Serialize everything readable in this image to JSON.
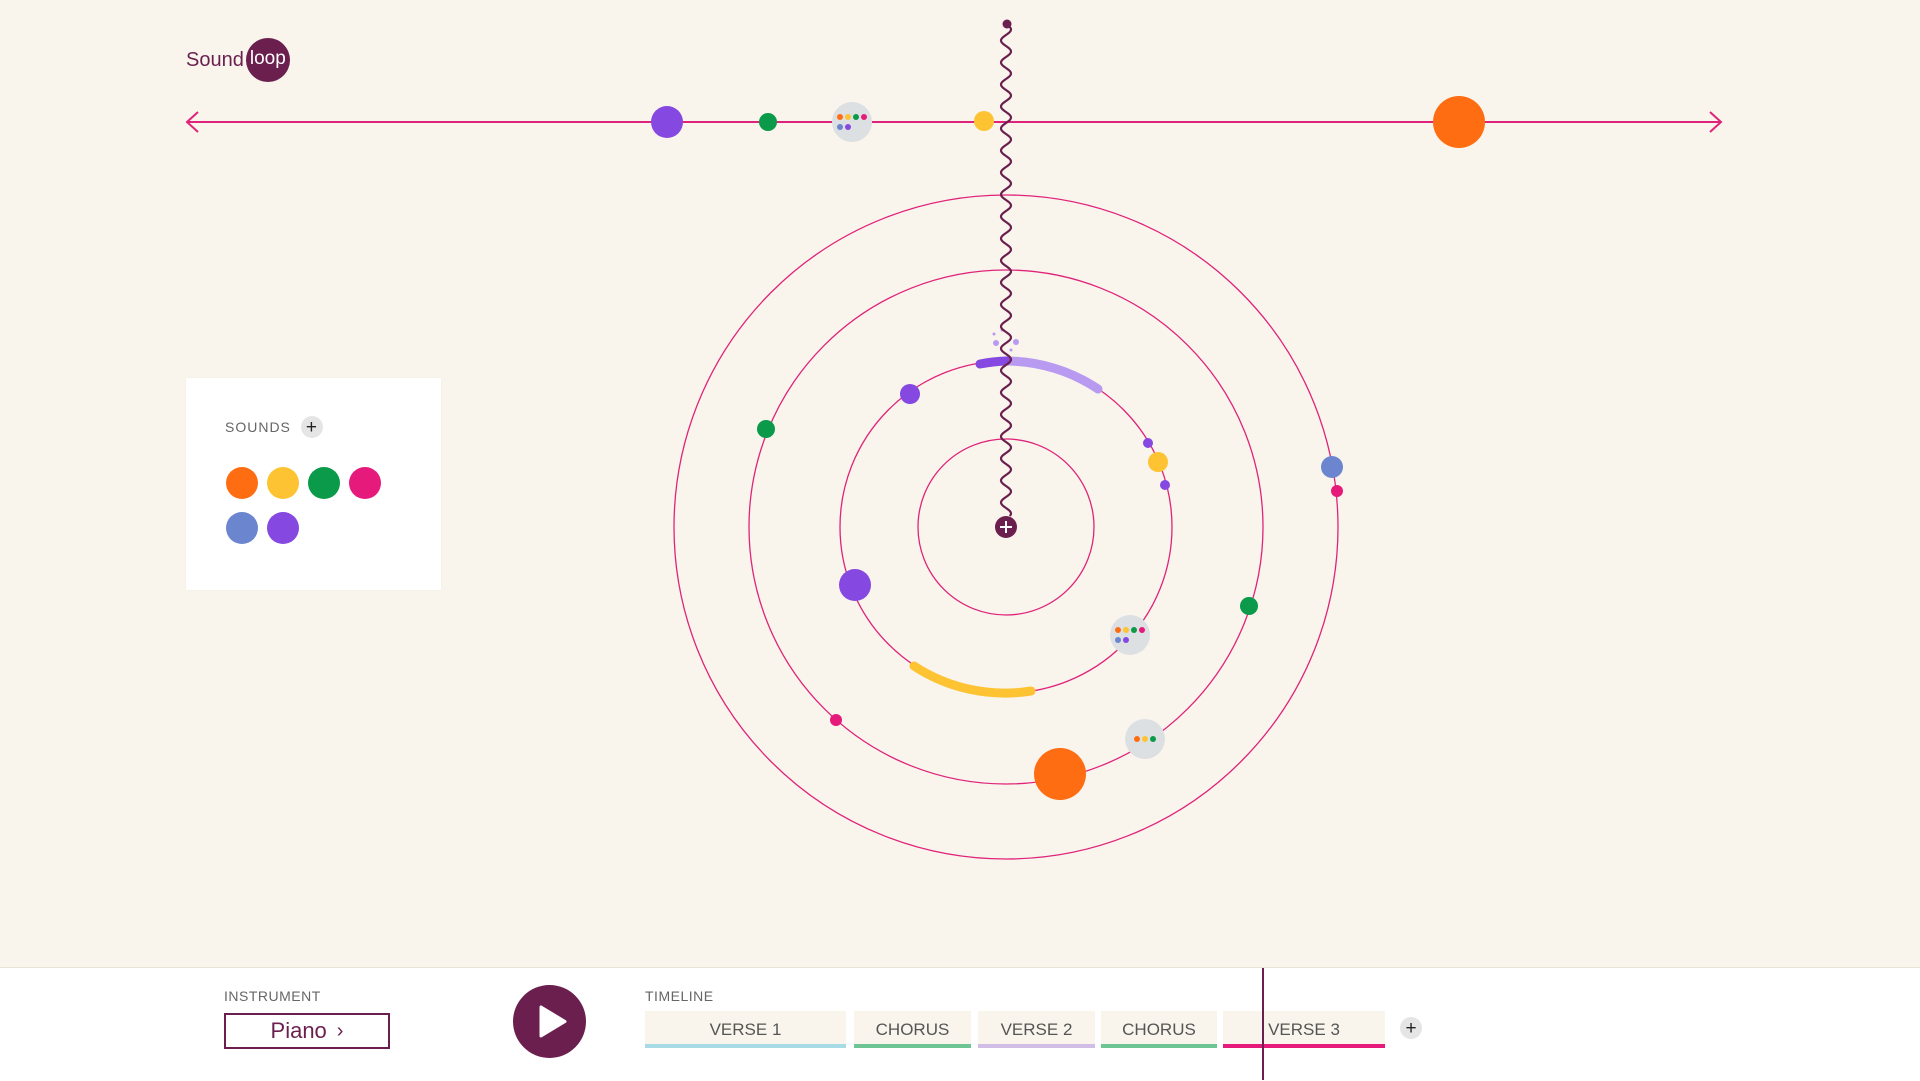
{
  "app": {
    "logo_word": "Sound",
    "logo_badge": "loop"
  },
  "colors": {
    "brand": "#6b1f4e",
    "accent_line": "#e0237a",
    "orange": "#ff6d12",
    "yellow": "#fdc333",
    "green": "#0a9a4a",
    "pink": "#e51a7b",
    "blue": "#6b85cf",
    "purple": "#8548e0",
    "group_bg": "#dde0e3"
  },
  "sounds_panel": {
    "title": "SOUNDS",
    "add_label": "+",
    "swatches": [
      {
        "name": "orange",
        "color": "#ff6d12"
      },
      {
        "name": "yellow",
        "color": "#fdc333"
      },
      {
        "name": "green",
        "color": "#0a9a4a"
      },
      {
        "name": "pink",
        "color": "#e51a7b"
      },
      {
        "name": "blue",
        "color": "#6b85cf"
      },
      {
        "name": "purple",
        "color": "#8548e0"
      }
    ]
  },
  "instrument": {
    "label": "INSTRUMENT",
    "value": "Piano",
    "chevron": "›"
  },
  "play": {
    "icon": "play-icon"
  },
  "timeline": {
    "label": "TIMELINE",
    "add_label": "+",
    "segments": [
      {
        "label": "VERSE 1",
        "bar": "#a7dbe5"
      },
      {
        "label": "CHORUS",
        "bar": "#6cc592"
      },
      {
        "label": "VERSE 2",
        "bar": "#d2bde6"
      },
      {
        "label": "CHORUS",
        "bar": "#6cc592"
      },
      {
        "label": "VERSE 3",
        "bar": "#e51a7b"
      }
    ]
  },
  "center_add_label": "+"
}
